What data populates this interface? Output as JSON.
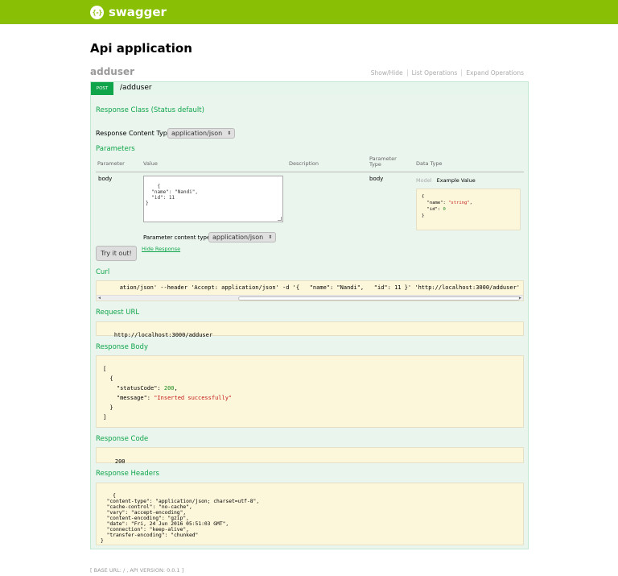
{
  "header": {
    "logo_glyph": "{-}",
    "brand": "swagger"
  },
  "page": {
    "title": "Api application"
  },
  "resource": {
    "name": "adduser",
    "operations": [
      "Show/Hide",
      "List Operations",
      "Expand Operations"
    ]
  },
  "operation": {
    "method": "POST",
    "path": "/adduser",
    "response_class": "Response Class (Status default)",
    "content_type_label": "Response Content Type",
    "content_type_value": "application/json",
    "parameters_title": "Parameters",
    "param_headers": {
      "parameter": "Parameter",
      "value": "Value",
      "description": "Description",
      "param_type": "Parameter Type",
      "data_type": "Data Type"
    },
    "param": {
      "name": "body",
      "value": "{\n  \"name\": \"Nandi\",\n  \"id\": 11\n}",
      "param_type": "body"
    },
    "model_tab": "Model",
    "example_tab": "Example Value",
    "param_content_type_label": "Parameter content type:",
    "param_content_type_value": "application/json",
    "try_button": "Try it out!",
    "hide_response": "Hide Response"
  },
  "curl": {
    "title": "Curl",
    "command": "ation/json' --header 'Accept: application/json' -d '{   \"name\": \"Nandi\",   \"id\": 11 }' 'http://localhost:3000/adduser'"
  },
  "request_url": {
    "title": "Request URL",
    "value": "http://localhost:3000/adduser"
  },
  "response_body": {
    "title": "Response Body"
  },
  "response_code": {
    "title": "Response Code",
    "value": "200"
  },
  "response_headers": {
    "title": "Response Headers",
    "value": "{\n  \"content-type\": \"application/json; charset=utf-8\",\n  \"cache-control\": \"no-cache\",\n  \"vary\": \"accept-encoding\",\n  \"content-encoding\": \"gzip\",\n  \"date\": \"Fri, 24 Jun 2016 05:51:03 GMT\",\n  \"connection\": \"keep-alive\",\n  \"transfer-encoding\": \"chunked\"\n}"
  },
  "footer": {
    "base_url_label": "BASE URL",
    "base_url": "/",
    "api_version_label": "API VERSION",
    "api_version": "0.0.1"
  }
}
